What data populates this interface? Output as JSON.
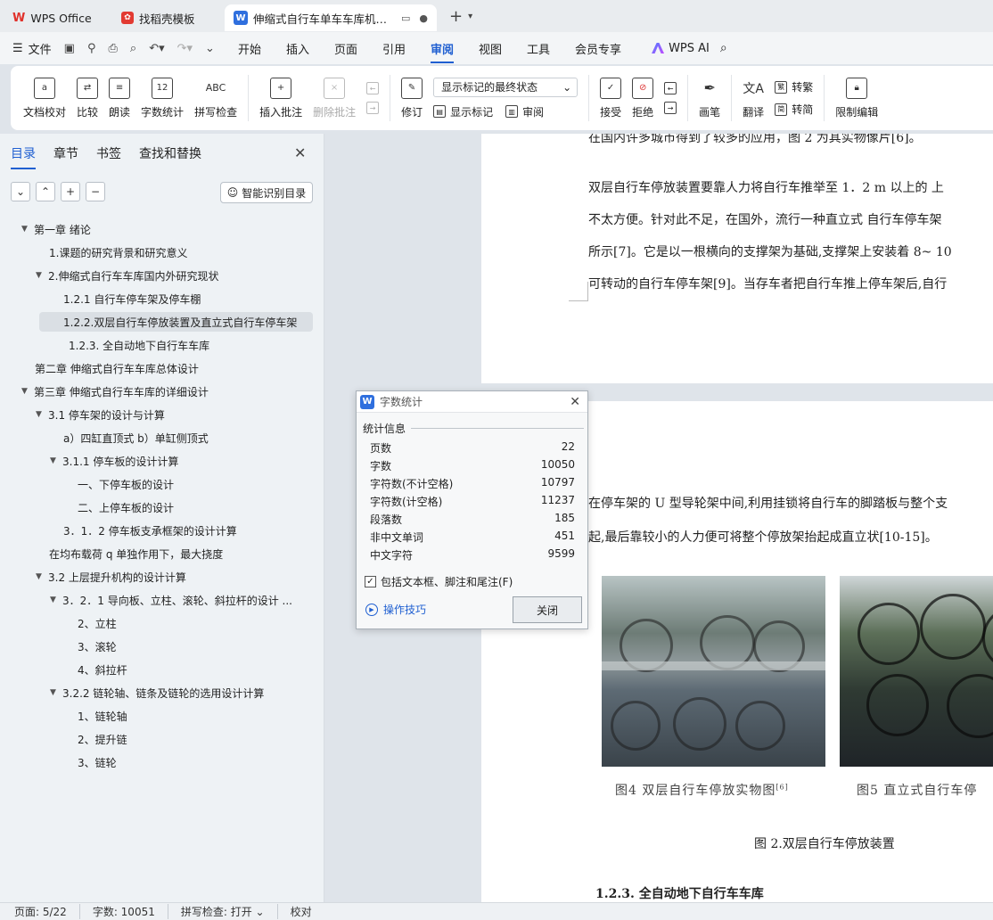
{
  "tabs": [
    {
      "label": "WPS Office"
    },
    {
      "label": "找稻壳模板"
    },
    {
      "label": "伸缩式自行车单车车库机械设计"
    }
  ],
  "menu": {
    "file": "文件",
    "items": [
      "开始",
      "插入",
      "页面",
      "引用",
      "审阅",
      "视图",
      "工具",
      "会员专享"
    ],
    "active": "审阅",
    "ai": "WPS AI"
  },
  "ribbon": {
    "doc_check": "文档校对",
    "compare": "比较",
    "read_aloud": "朗读",
    "word_count": "字数统计",
    "spell_check": "拼写检查",
    "insert_comment": "插入批注",
    "delete_comment": "删除批注",
    "revise": "修订",
    "markup_select": "显示标记的最终状态",
    "show_markup": "显示标记",
    "review": "审阅",
    "accept": "接受",
    "reject": "拒绝",
    "pen": "画笔",
    "translate": "翻译",
    "to_traditional": "转繁",
    "to_simplified": "转简",
    "restrict_edit": "限制编辑",
    "word_count_icon_text": "12",
    "spell_icon_text": "ABC"
  },
  "nav": {
    "tabs": [
      "目录",
      "章节",
      "书签",
      "查找和替换"
    ],
    "smart_toc": "智能识别目录",
    "toc": [
      "第一章  绪论",
      "1.课题的研究背景和研究意义",
      "2.伸缩式自行车车库国内外研究现状",
      "1.2.1    自行车停车架及停车棚",
      "1.2.2.双层自行车停放装置及直立式自行车停车架",
      "1.2.3.  全自动地下自行车车库",
      "第二章  伸缩式自行车车库总体设计",
      "第三章  伸缩式自行车车库的详细设计",
      "3.1    停车架的设计与计算",
      "a）四缸直顶式   b）单缸侧顶式",
      "3.1.1    停车板的设计计算",
      "一、下停车板的设计",
      "二、上停车板的设计",
      "3．1．2    停车板支承框架的设计计算",
      "在均布载荷 q 单独作用下，最大挠度",
      "3.2    上层提升机构的设计计算",
      "3．2．1    导向板、立柱、滚轮、斜拉杆的设计 ...",
      "2、立柱",
      "3、滚轮",
      "4、斜拉杆",
      "3.2.2    链轮轴、链条及链轮的选用设计计算",
      "1、链轮轴",
      "2、提升链",
      "3、链轮"
    ]
  },
  "doc": {
    "p1_lines": [
      "在国内许多城市得到了较多的应用，图 2 为其实物像片[6]。",
      "双层自行车停放装置要靠人力将自行车推举至  1．2 m 以上的 上",
      "不太方便。针对此不足，在国外，流行一种直立式 自行车停车架",
      "所示[7]。它是以一根横向的支撑架为基础,支撑架上安装着 8~ 10",
      "可转动的自行车停车架[9]。当存车者把自行车推上停车架后,自行"
    ],
    "p2_lines": [
      "在停车架的 U 型导轮架中间,利用挂锁将自行车的脚踏板与整个支",
      "起,最后靠较小的人力便可将整个停放架抬起成直立状[10-15]。"
    ],
    "fig4_caption": "图4  双层自行车停放实物图",
    "fig4_ref": "[6]",
    "fig5_caption": "图5  直立式自行车停",
    "fig_title": "图 2.双层自行车停放装置",
    "section_title": "1.2.3. 全自动地下自行车车库"
  },
  "dialog": {
    "title": "字数统计",
    "section": "统计信息",
    "stats": [
      {
        "label": "页数",
        "value": "22"
      },
      {
        "label": "字数",
        "value": "10050"
      },
      {
        "label": "字符数(不计空格)",
        "value": "10797"
      },
      {
        "label": "字符数(计空格)",
        "value": "11237"
      },
      {
        "label": "段落数",
        "value": "185"
      },
      {
        "label": "非中文单词",
        "value": "451"
      },
      {
        "label": "中文字符",
        "value": "9599"
      }
    ],
    "include_label": "包括文本框、脚注和尾注(F)",
    "tips": "操作技巧",
    "close": "关闭"
  },
  "status": {
    "page": "页面: 5/22",
    "words": "字数: 10051",
    "spell": "拼写检查: 打开",
    "proof": "校对"
  },
  "colors": {
    "accent": "#1f5fd1",
    "wps_red": "#e0312b"
  }
}
